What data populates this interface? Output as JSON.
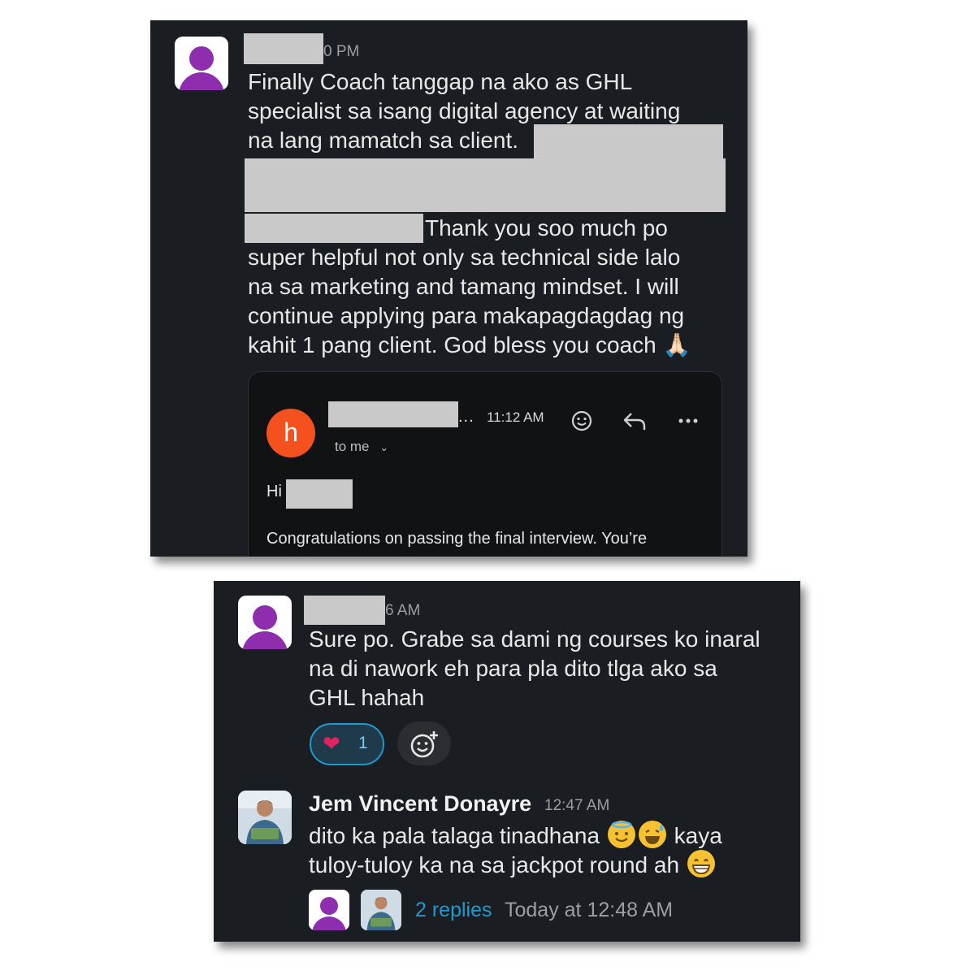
{
  "post1": {
    "time_visible": "0 PM",
    "message_lines": [
      "Finally Coach tanggap na ako as GHL",
      "specialist sa isang digital agency at waiting",
      "na lang mamatch sa client."
    ],
    "message_lines_2": [
      "Thank you soo much po",
      "super helpful not only sa technical side lalo",
      "na sa marketing and tamang mindset. I will",
      "continue applying para makapagdagdag ng",
      "kahit 1 pang client. God bless you coach"
    ],
    "emoji": "🙏🏻",
    "email": {
      "avatar_letter": "h",
      "sender_ellipsis": "...",
      "time": "11:12 AM",
      "to": "to me",
      "greeting": "Hi",
      "body": "Congratulations on passing the final interview. You’re"
    }
  },
  "post2": {
    "time_visible": "6 AM",
    "message_lines": [
      "Sure po. Grabe sa dami ng courses ko inaral",
      "na di nawork eh para pla dito tlga ako sa",
      "GHL hahah"
    ],
    "reaction": {
      "emoji": "❤",
      "count": "1"
    }
  },
  "reply": {
    "name": "Jem Vincent Donayre",
    "time": "12:47 AM",
    "line1": "dito ka pala talaga tinadhana",
    "line1_end": "kaya",
    "line2": "tuloy-tuloy ka na sa jackpot round ah"
  },
  "thread": {
    "replies": "2 replies",
    "last_reply": "Today at 12:48 AM"
  },
  "colors": {
    "background": "#1a1d21",
    "link": "#1d9bd1",
    "avatar_purple": "#8e2dae",
    "email_avatar": "#f4511e"
  }
}
